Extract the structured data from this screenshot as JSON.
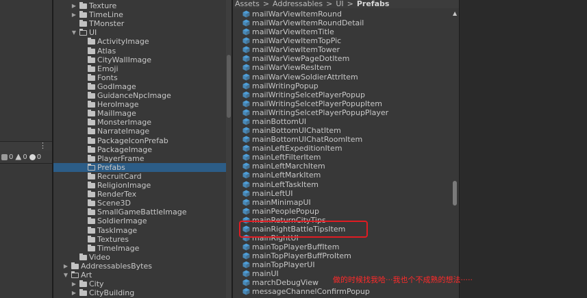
{
  "console": {
    "menu_label": "⋮",
    "counts": [
      {
        "icon": "info-icon",
        "value": "0"
      },
      {
        "icon": "warning-icon",
        "value": "0"
      },
      {
        "icon": "error-icon",
        "value": "0"
      }
    ]
  },
  "tree": {
    "selected_color": "#2c5d87",
    "items": [
      {
        "label": "Texture",
        "level": 2,
        "arrow": "▶",
        "open": false,
        "selected": false
      },
      {
        "label": "TimeLine",
        "level": 2,
        "arrow": "▶",
        "open": false,
        "selected": false
      },
      {
        "label": "TMonster",
        "level": 2,
        "arrow": "",
        "open": false,
        "selected": false
      },
      {
        "label": "UI",
        "level": 2,
        "arrow": "▼",
        "open": true,
        "selected": false
      },
      {
        "label": "ActivityImage",
        "level": 3,
        "arrow": "",
        "open": false,
        "selected": false
      },
      {
        "label": "Atlas",
        "level": 3,
        "arrow": "",
        "open": false,
        "selected": false
      },
      {
        "label": "CityWallImage",
        "level": 3,
        "arrow": "",
        "open": false,
        "selected": false
      },
      {
        "label": "Emoji",
        "level": 3,
        "arrow": "",
        "open": false,
        "selected": false
      },
      {
        "label": "Fonts",
        "level": 3,
        "arrow": "",
        "open": false,
        "selected": false
      },
      {
        "label": "GodImage",
        "level": 3,
        "arrow": "",
        "open": false,
        "selected": false
      },
      {
        "label": "GuidanceNpcImage",
        "level": 3,
        "arrow": "",
        "open": false,
        "selected": false
      },
      {
        "label": "HeroImage",
        "level": 3,
        "arrow": "",
        "open": false,
        "selected": false
      },
      {
        "label": "MailImage",
        "level": 3,
        "arrow": "",
        "open": false,
        "selected": false
      },
      {
        "label": "MonsterImage",
        "level": 3,
        "arrow": "",
        "open": false,
        "selected": false
      },
      {
        "label": "NarrateImage",
        "level": 3,
        "arrow": "",
        "open": false,
        "selected": false
      },
      {
        "label": "PackageIconPrefab",
        "level": 3,
        "arrow": "",
        "open": false,
        "selected": false
      },
      {
        "label": "PackageImage",
        "level": 3,
        "arrow": "",
        "open": false,
        "selected": false
      },
      {
        "label": "PlayerFrame",
        "level": 3,
        "arrow": "",
        "open": false,
        "selected": false
      },
      {
        "label": "Prefabs",
        "level": 3,
        "arrow": "",
        "open": true,
        "selected": true
      },
      {
        "label": "RecruitCard",
        "level": 3,
        "arrow": "",
        "open": false,
        "selected": false
      },
      {
        "label": "ReligionImage",
        "level": 3,
        "arrow": "",
        "open": false,
        "selected": false
      },
      {
        "label": "RenderTex",
        "level": 3,
        "arrow": "",
        "open": false,
        "selected": false
      },
      {
        "label": "Scene3D",
        "level": 3,
        "arrow": "",
        "open": false,
        "selected": false
      },
      {
        "label": "SmallGameBattleImage",
        "level": 3,
        "arrow": "",
        "open": false,
        "selected": false
      },
      {
        "label": "SoldierImage",
        "level": 3,
        "arrow": "",
        "open": false,
        "selected": false
      },
      {
        "label": "TaskImage",
        "level": 3,
        "arrow": "",
        "open": false,
        "selected": false
      },
      {
        "label": "Textures",
        "level": 3,
        "arrow": "",
        "open": false,
        "selected": false
      },
      {
        "label": "TimeImage",
        "level": 3,
        "arrow": "",
        "open": false,
        "selected": false
      },
      {
        "label": "Video",
        "level": 2,
        "arrow": "",
        "open": false,
        "selected": false
      },
      {
        "label": "AddressablesBytes",
        "level": 1,
        "arrow": "▶",
        "open": false,
        "selected": false
      },
      {
        "label": "Art",
        "level": 1,
        "arrow": "▼",
        "open": true,
        "selected": false
      },
      {
        "label": "City",
        "level": 2,
        "arrow": "▶",
        "open": false,
        "selected": false
      },
      {
        "label": "CityBuilding",
        "level": 2,
        "arrow": "▶",
        "open": false,
        "selected": false
      }
    ]
  },
  "breadcrumb": {
    "parts": [
      "Assets",
      "Addressables",
      "UI"
    ],
    "current": "Prefabs",
    "separator": ">"
  },
  "files": {
    "icon": "prefab-cube-icon",
    "icon_color": "#4fa3e0",
    "items": [
      "mailWarViewItemRound",
      "mailWarViewItemRoundDetail",
      "mailWarViewItemTitle",
      "mailWarViewItemTopPic",
      "mailWarViewItemTower",
      "mailWarViewPageDotItem",
      "mailWarViewResItem",
      "mailWarViewSoldierAttrItem",
      "mailWritingPopup",
      "mailWritingSelcetPlayerPopup",
      "mailWritingSelcetPlayerPopupItem",
      "mailWritingSelcetPlayerPopupPlayer",
      "mainBottomUI",
      "mainBottomUIChatItem",
      "mainBottomUIChatRoomItem",
      "mainLeftExpeditionItem",
      "mainLeftFilterItem",
      "mainLeftMarchItem",
      "mainLeftMarkItem",
      "mainLeftTaskItem",
      "mainLeftUI",
      "mainMinimapUI",
      "mainPeoplePopup",
      "mainReturnCityTips",
      "mainRightBattleTipsItem",
      "mainRightUI",
      "mainTopPlayerBuffItem",
      "mainTopPlayerBuffProItem",
      "mainTopPlayerUI",
      "mainUI",
      "marchDebugView",
      "messageChannelConfirmPopup"
    ]
  },
  "annotation": {
    "text": "做的时候找我哈···我也个不成熟的想法·····",
    "color": "#ff2a2a"
  },
  "colors": {
    "panel_bg": "#383838",
    "highlight_border": "#e11b22"
  }
}
